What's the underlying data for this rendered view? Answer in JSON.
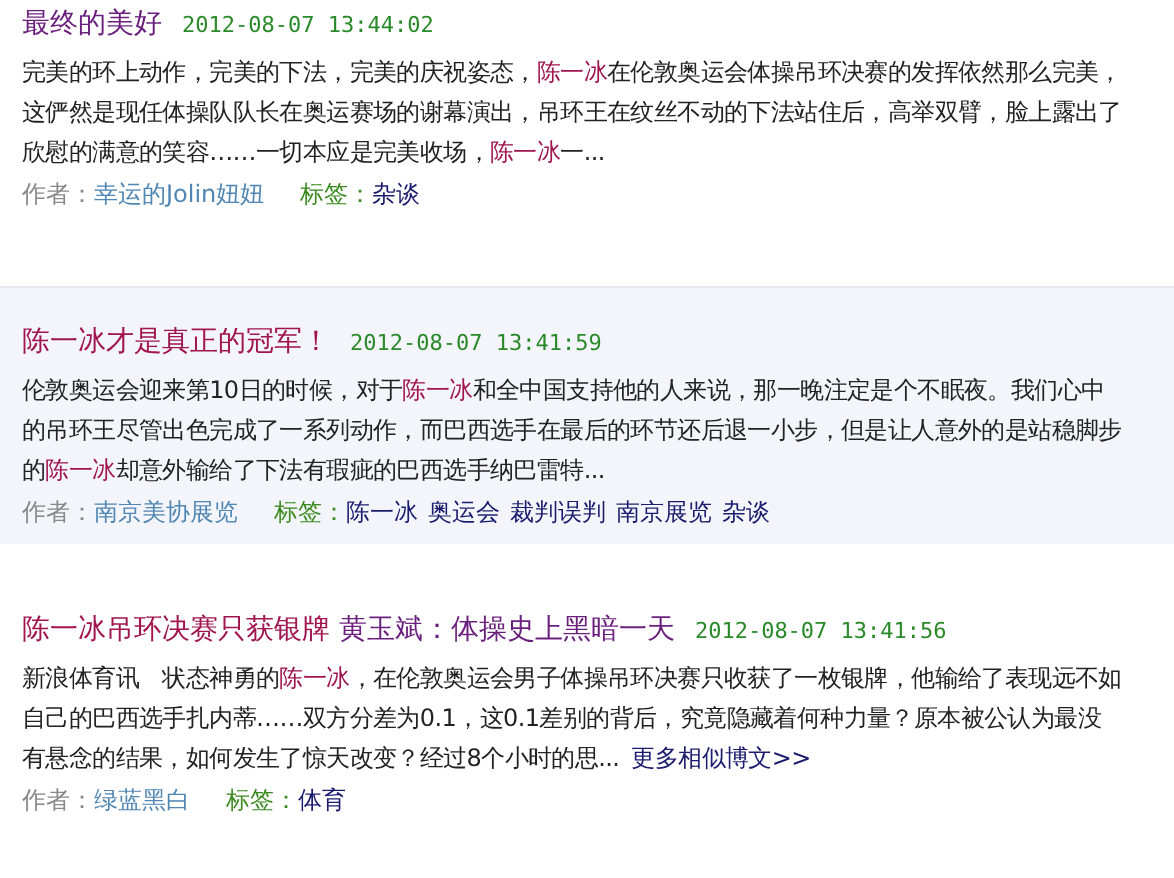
{
  "posts": [
    {
      "highlighted": false,
      "title": [
        {
          "text": "最终的美好",
          "keyword": false
        }
      ],
      "date": "2012-08-07 13:44:02",
      "body": [
        {
          "text": "完美的环上动作，完美的下法，完美的庆祝姿态，",
          "keyword": false
        },
        {
          "text": "陈一冰",
          "keyword": true
        },
        {
          "text": "在伦敦奥运会体操吊环决赛的发挥依然那么完美，这俨然是现任体操队队长在奥运赛场的谢幕演出，吊环王在纹丝不动的下法站住后，高举双臂，脸上露出了欣慰的满意的笑容……一切本应是完美收场，",
          "keyword": false
        },
        {
          "text": "陈一冰",
          "keyword": true
        },
        {
          "text": "一...",
          "keyword": false
        }
      ],
      "author_label": "作者：",
      "author": "幸运的Jolin妞妞",
      "tags_label": "标签：",
      "tags": [
        "杂谈"
      ]
    },
    {
      "highlighted": true,
      "title": [
        {
          "text": "陈一冰才是真正的冠军！",
          "keyword": true
        }
      ],
      "date": "2012-08-07 13:41:59",
      "body": [
        {
          "text": "伦敦奥运会迎来第10日的时候，对于",
          "keyword": false
        },
        {
          "text": "陈一冰",
          "keyword": true
        },
        {
          "text": "和全中国支持他的人来说，那一晚注定是个不眠夜。我们心中的吊环王尽管出色完成了一系列动作，而巴西选手在最后的环节还后退一小步，但是让人意外的是站稳脚步的",
          "keyword": false
        },
        {
          "text": "陈一冰",
          "keyword": true
        },
        {
          "text": "却意外输给了下法有瑕疵的巴西选手纳巴雷特...",
          "keyword": false
        }
      ],
      "author_label": "作者：",
      "author": "南京美协展览",
      "tags_label": "标签：",
      "tags": [
        "陈一冰",
        "奥运会",
        "裁判误判",
        "南京展览",
        "杂谈"
      ]
    },
    {
      "highlighted": false,
      "title": [
        {
          "text": "陈一冰吊环决赛只获银牌",
          "keyword": true
        },
        {
          "text": "  黄玉斌：体操史上黑暗一天",
          "keyword": false
        }
      ],
      "date": "2012-08-07 13:41:56",
      "body": [
        {
          "text": "新浪体育讯　状态神勇的",
          "keyword": false
        },
        {
          "text": "陈一冰",
          "keyword": true
        },
        {
          "text": "，在伦敦奥运会男子体操吊环决赛只收获了一枚银牌，他输给了表现远不如自己的巴西选手扎内蒂……双方分差为0.1，这0.1差别的背后，究竟隐藏着何种力量？原本被公认为最没有悬念的结果，如何发生了惊天改变？经过8个小时的思...",
          "keyword": false
        }
      ],
      "more_link": "更多相似博文>>",
      "author_label": "作者：",
      "author": "绿蓝黑白",
      "tags_label": "标签：",
      "tags": [
        "体育"
      ]
    }
  ]
}
